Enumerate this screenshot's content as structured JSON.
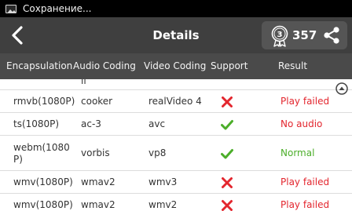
{
  "statusbar": {
    "message": "Сохранение..."
  },
  "header": {
    "title": "Details",
    "score": "357"
  },
  "columns": {
    "encapsulation": "Encapsulation",
    "audio": "Audio Coding",
    "video": "Video Coding",
    "support": "Support",
    "result": "Result"
  },
  "partial_row": {
    "audio_fragment": "ll"
  },
  "rows": [
    {
      "encapsulation": "rmvb(1080P)",
      "audio": "cooker",
      "video": "realVideo 4",
      "support": "cross-icon",
      "result": "Play failed",
      "result_color": "#e3262e"
    },
    {
      "encapsulation": "ts(1080P)",
      "audio": "ac-3",
      "video": "avc",
      "support": "check-icon",
      "result": "No audio",
      "result_color": "#e3262e"
    },
    {
      "encapsulation": "webm(1080P)",
      "audio": "vorbis",
      "video": "vp8",
      "support": "check-icon",
      "result": "Normal",
      "result_color": "#4cae2a"
    },
    {
      "encapsulation": "wmv(1080P)",
      "audio": "wmav2",
      "video": "wmv3",
      "support": "cross-icon",
      "result": "Play failed",
      "result_color": "#e3262e"
    },
    {
      "encapsulation": "wmv(1080P)",
      "audio": "wmav2",
      "video": "wmv2",
      "support": "cross-icon",
      "result": "Play failed",
      "result_color": "#e3262e"
    }
  ],
  "colors": {
    "fail": "#e3262e",
    "ok": "#4cae2a",
    "header_bg": "#3f3f3f",
    "column_bg": "#4a4a4a"
  }
}
